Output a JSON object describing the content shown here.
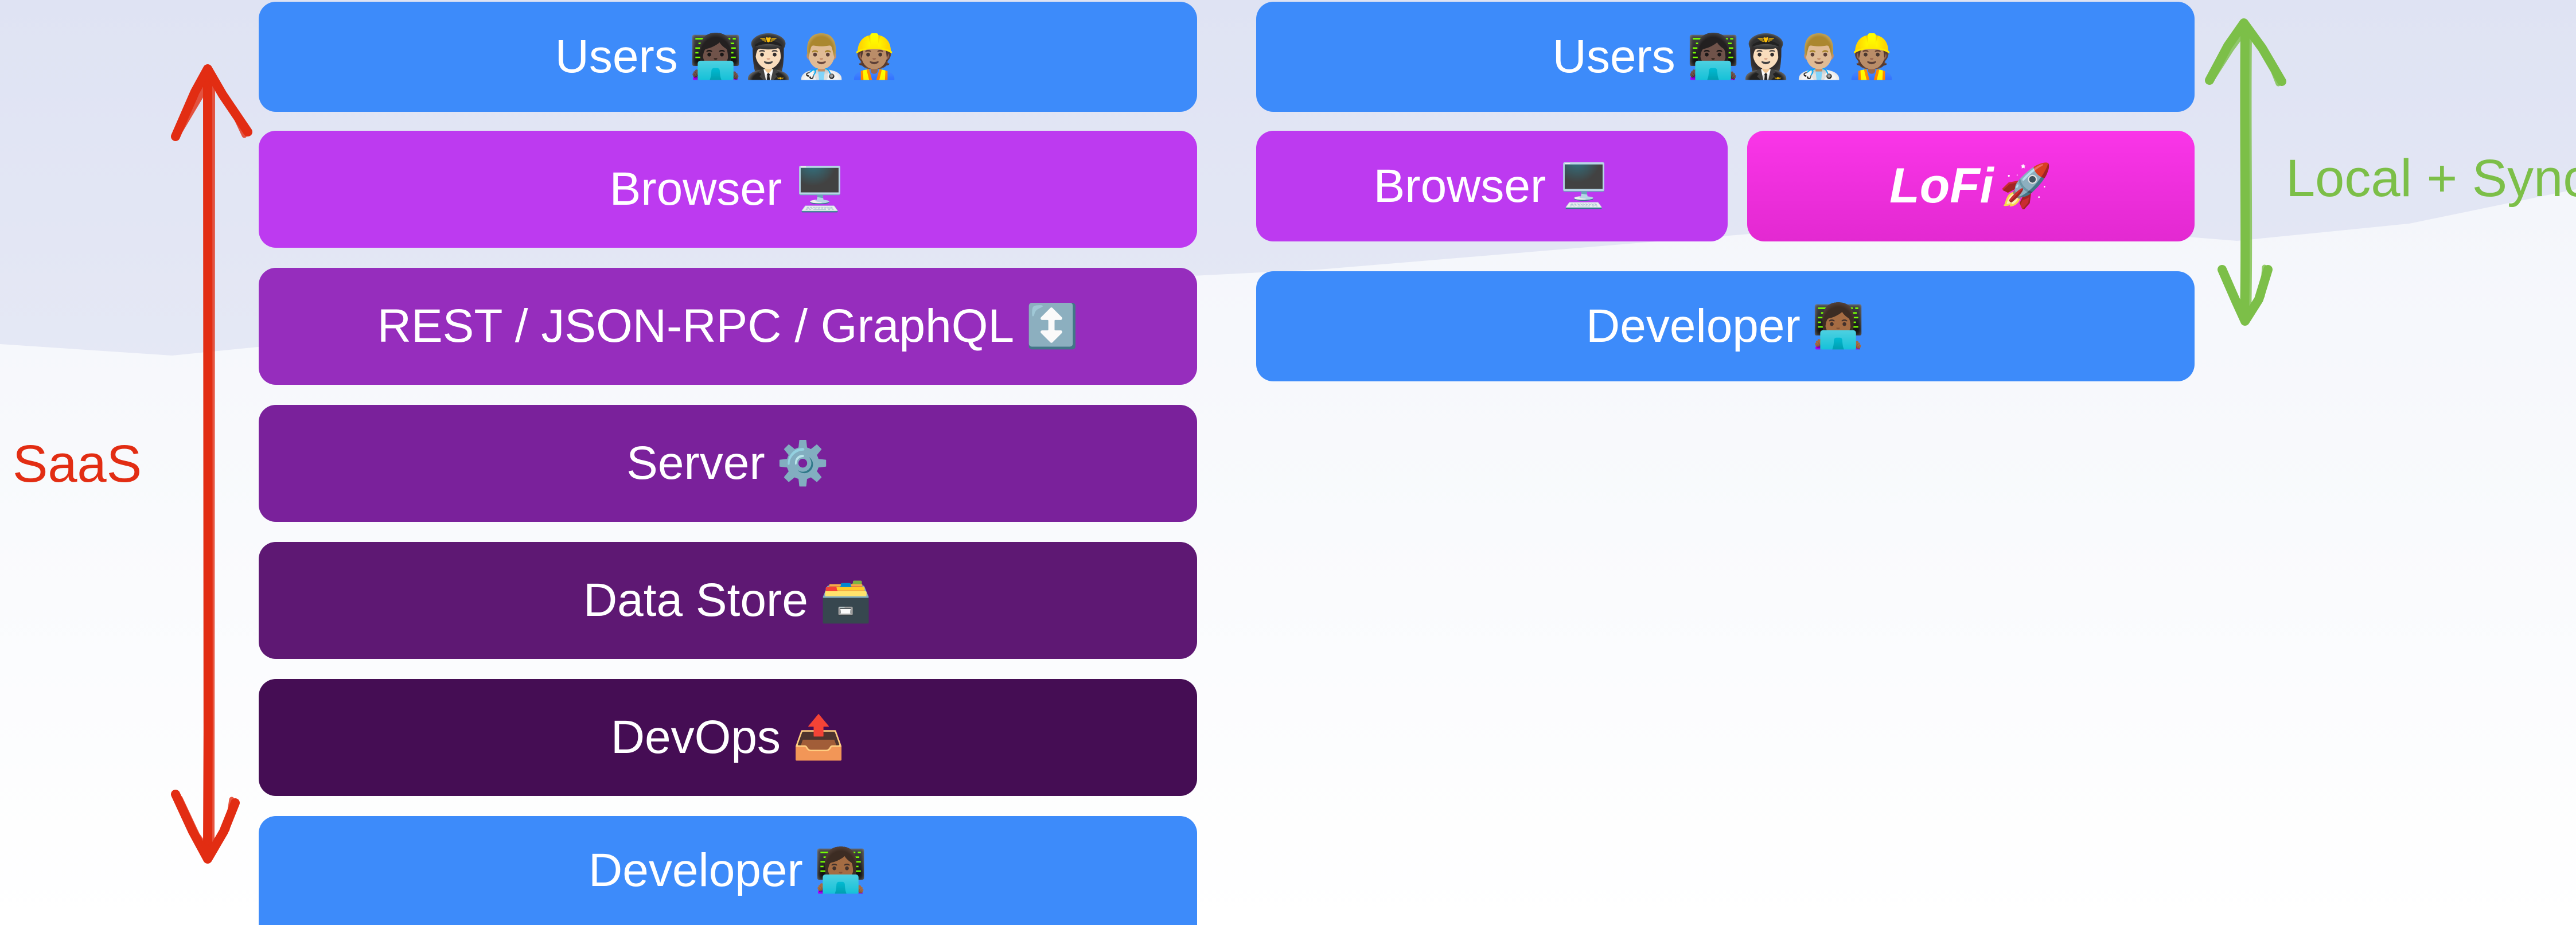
{
  "colors": {
    "blue": "#3d8bfa",
    "browser": "#bd3af0",
    "transport": "#962dbd",
    "server": "#7a219b",
    "datastore": "#5e1873",
    "devops": "#450d54",
    "lofi": "#f032e0",
    "saas": "#e22d13",
    "local_sync": "#7cbf48"
  },
  "saas_stack": {
    "users": {
      "label": "Users",
      "emoji": "👩🏿‍💻👩🏻‍✈️👨🏼‍⚕️👷🏽"
    },
    "browser": {
      "label": "Browser",
      "emoji": "🖥️"
    },
    "transport": {
      "label": "REST / JSON-RPC / GraphQL",
      "emoji": "↕️"
    },
    "server": {
      "label": "Server",
      "emoji": "⚙️"
    },
    "datastore": {
      "label": "Data Store",
      "emoji": "🗃️"
    },
    "devops": {
      "label": "DevOps",
      "emoji": "📤"
    },
    "developer": {
      "label": "Developer",
      "emoji": "👩🏾‍💻"
    }
  },
  "local_stack": {
    "users": {
      "label": "Users",
      "emoji": "👩🏿‍💻👩🏻‍✈️👨🏼‍⚕️👷🏽"
    },
    "browser": {
      "label": "Browser",
      "emoji": "🖥️"
    },
    "lofi": {
      "label": "LoFi",
      "emoji": "🚀"
    },
    "developer": {
      "label": "Developer",
      "emoji": "👩🏾‍💻"
    }
  },
  "labels": {
    "saas": "SaaS",
    "local_sync": "Local + Sync"
  }
}
